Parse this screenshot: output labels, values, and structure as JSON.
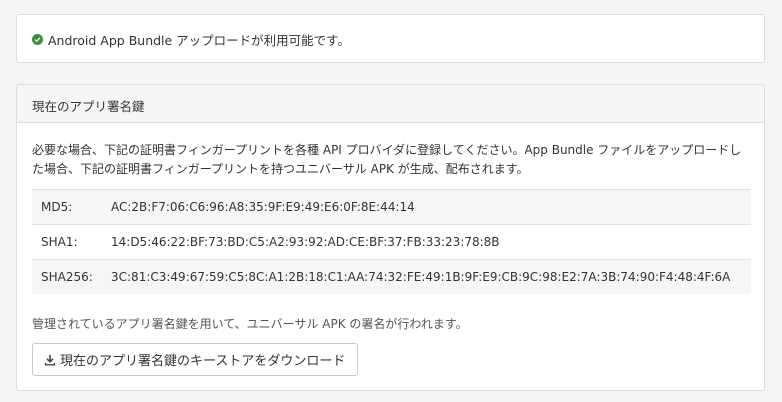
{
  "notice": {
    "icon": "check-circle-icon",
    "text": "Android App Bundle アップロードが利用可能です。",
    "icon_color": "#3c8d3c"
  },
  "signing_key": {
    "title": "現在のアプリ署名鍵",
    "description": "必要な場合、下記の証明書フィンガープリントを各種 API プロバイダに登録してください。App Bundle ファイルをアップロードした場合、下記の証明書フィンガープリントを持つユニバーサル APK が生成、配布されます。",
    "fingerprints": [
      {
        "label": "MD5:",
        "value": "AC:2B:F7:06:C6:96:A8:35:9F:E9:49:E6:0F:8E:44:14"
      },
      {
        "label": "SHA1:",
        "value": "14:D5:46:22:BF:73:BD:C5:A2:93:92:AD:CE:BF:37:FB:33:23:78:8B"
      },
      {
        "label": "SHA256:",
        "value": "3C:81:C3:49:67:59:C5:8C:A1:2B:18:C1:AA:74:32:FE:49:1B:9F:E9:CB:9C:98:E2:7A:3B:74:90:F4:48:4F:6A"
      }
    ],
    "managed_note": "管理されているアプリ署名鍵を用いて、ユニバーサル APK の署名が行われます。",
    "download_button": {
      "icon": "download-icon",
      "label": "現在のアプリ署名鍵のキーストアをダウンロード"
    }
  }
}
